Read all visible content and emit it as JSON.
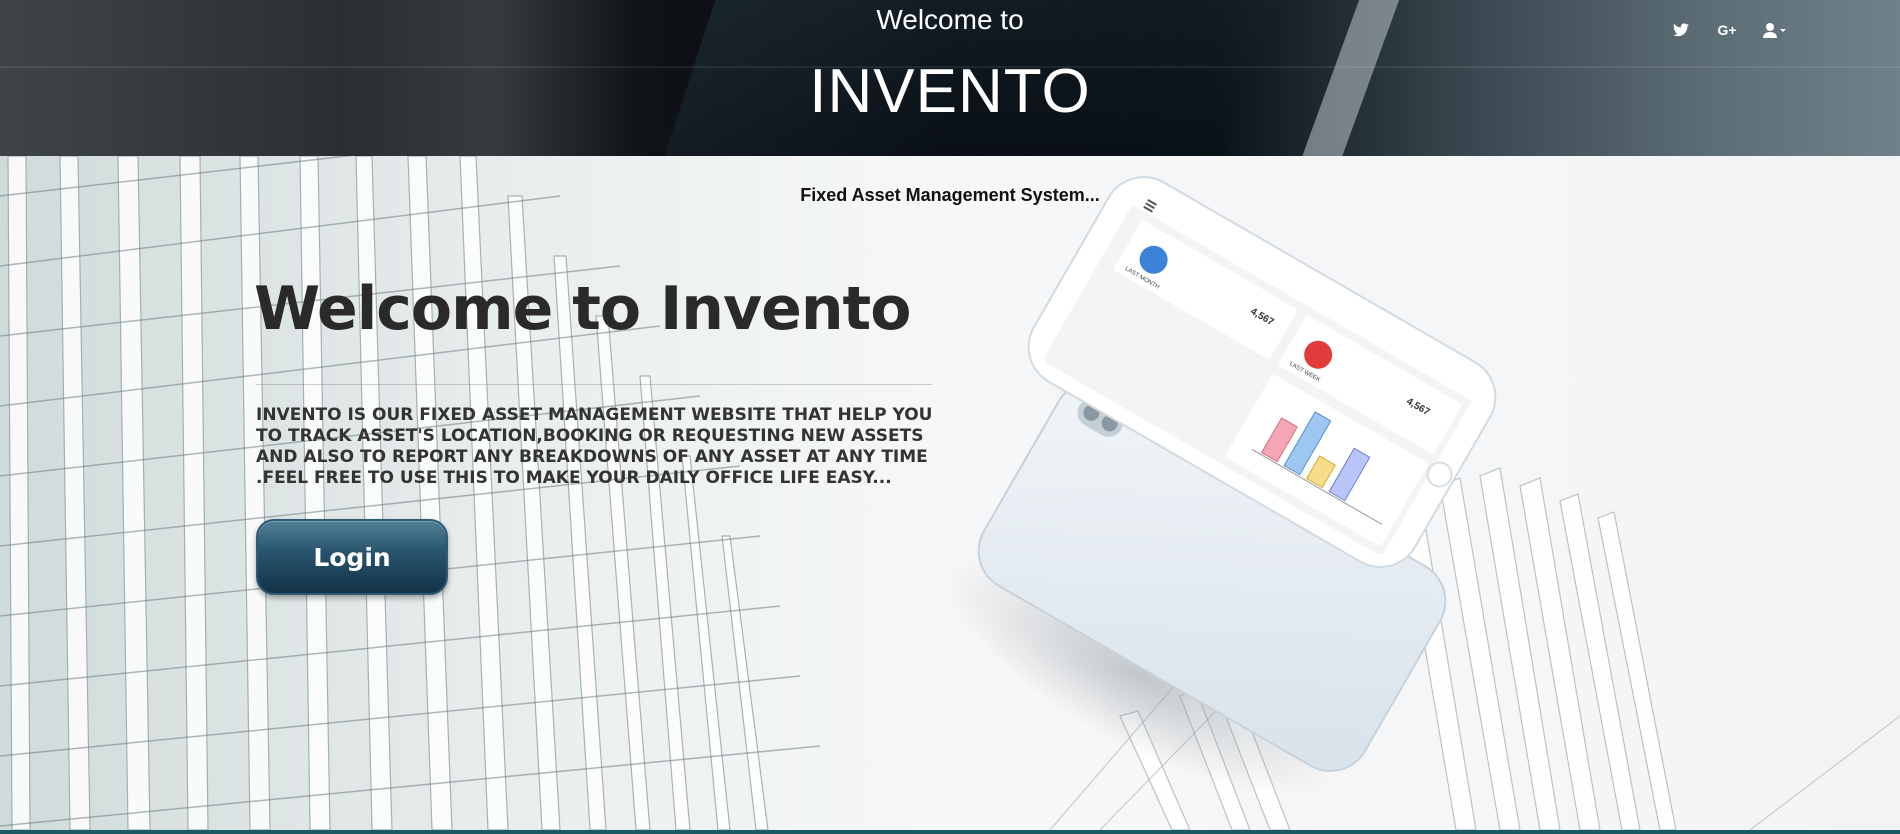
{
  "header": {
    "welcome_small": "Welcome to",
    "brand": "INVENTO",
    "icons": [
      "twitter-icon",
      "google-plus-icon",
      "user-dropdown-icon"
    ],
    "google_plus_glyph": "G+"
  },
  "hero": {
    "subtitle": "Fixed Asset Management System...",
    "title": "Welcome to Invento",
    "description": "INVENTO IS OUR FIXED ASSET MANAGEMENT WEBSITE THAT HELP YOU TO TRACK ASSET'S LOCATION,BOOKING OR REQUESTING NEW ASSETS AND ALSO TO REPORT ANY BREAKDOWNS OF ANY ASSET AT ANY TIME .FEEL FREE TO USE THIS TO MAKE YOUR DAILY OFFICE LIFE EASY...",
    "login_label": "Login"
  },
  "phone_screen": {
    "card1_value": "4,567",
    "card1_label": "LAST MONTH",
    "card2_value": "4,567",
    "card2_label": "LAST WEEK"
  },
  "colors": {
    "button_top": "#4f8096",
    "button_bottom": "#133347",
    "accent_bar": "#1a5b63",
    "header_dark": "#04080d"
  }
}
